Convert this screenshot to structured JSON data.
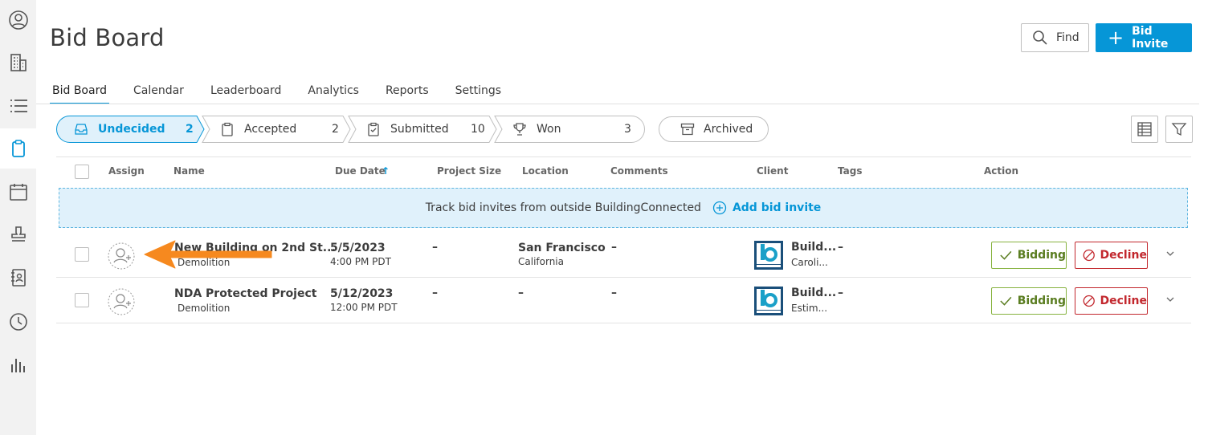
{
  "sidebar": {
    "items": [
      {
        "name": "user-circle-icon"
      },
      {
        "name": "building-icon"
      },
      {
        "name": "list-icon"
      },
      {
        "name": "clipboard-icon",
        "active": true
      },
      {
        "name": "calendar-icon"
      },
      {
        "name": "stamp-icon"
      },
      {
        "name": "address-book-icon"
      },
      {
        "name": "clock-icon"
      },
      {
        "name": "bar-chart-icon"
      }
    ]
  },
  "header": {
    "title": "Bid Board",
    "find_label": "Find",
    "invite_label": "Bid Invite"
  },
  "tabs": [
    "Bid Board",
    "Calendar",
    "Leaderboard",
    "Analytics",
    "Reports",
    "Settings"
  ],
  "pipeline": {
    "stages": [
      {
        "label": "Undecided",
        "count": "2",
        "active": true
      },
      {
        "label": "Accepted",
        "count": "2"
      },
      {
        "label": "Submitted",
        "count": "10"
      },
      {
        "label": "Won",
        "count": "3"
      }
    ],
    "archived_label": "Archived"
  },
  "table": {
    "columns": {
      "assign": "Assign",
      "name": "Name",
      "due_date": "Due Date",
      "project_size": "Project Size",
      "location": "Location",
      "comments": "Comments",
      "client": "Client",
      "tags": "Tags",
      "action": "Action"
    },
    "banner_text": "Track bid invites from outside BuildingConnected",
    "banner_action": "Add bid invite",
    "rows": [
      {
        "name": "New Building on 2nd St...",
        "trade": "Demolition",
        "date": "5/5/2023",
        "time": "4:00 PM PDT",
        "size": "–",
        "city": "San Francisco",
        "state": "California",
        "comments": "–",
        "client": "Build...",
        "client_sub": "Caroli...",
        "tags": "–",
        "bid_label": "Bidding",
        "decline_label": "Decline"
      },
      {
        "name": "NDA Protected Project",
        "trade": "Demolition",
        "date": "5/12/2023",
        "time": "12:00 PM PDT",
        "size": "–",
        "city": "–",
        "state": "",
        "comments": "–",
        "client": "Build...",
        "client_sub": "Estim...",
        "tags": "–",
        "bid_label": "Bidding",
        "decline_label": "Decline"
      }
    ]
  },
  "colors": {
    "accent": "#0696d7",
    "bidding": "#87b340",
    "decline": "#c2272d",
    "annotation_arrow": "#f6891f"
  }
}
